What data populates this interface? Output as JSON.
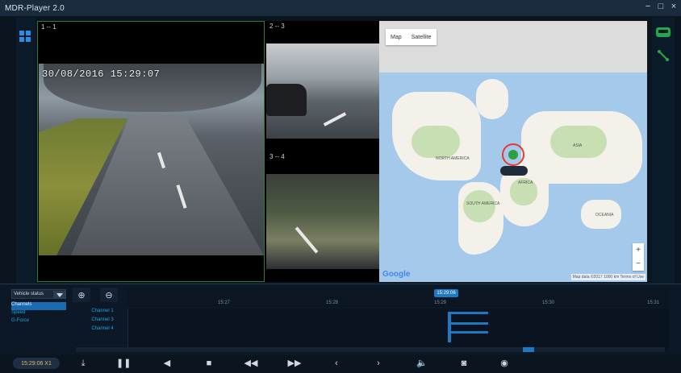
{
  "app": {
    "title": "MDR-Player 2.0"
  },
  "window_controls": {
    "minimize": "−",
    "restore": "□",
    "close": "×"
  },
  "video": {
    "panes": [
      {
        "label": "1 -- 1"
      },
      {
        "label": "2 -- 3"
      },
      {
        "label": "3 -- 4"
      }
    ],
    "main_timestamp": "30/08/2016 15:29:07"
  },
  "map": {
    "tabs": {
      "map": "Map",
      "satellite": "Satellite"
    },
    "labels": {
      "north_america": "NORTH AMERICA",
      "south_america": "SOUTH AMERICA",
      "africa": "AFRICA",
      "asia": "ASIA",
      "oceania": "OCEANIA"
    },
    "zoom_in": "+",
    "zoom_out": "−",
    "google": "Google",
    "attribution": "Map data ©2017   1000 km   Terms of Use"
  },
  "timeline": {
    "vehicle_status_label": "Vehicle status",
    "zoom_in_label": "⊕",
    "zoom_out_label": "⊖",
    "status_items": [
      {
        "label": "Channels",
        "selected": true
      },
      {
        "label": "Speed",
        "selected": false
      },
      {
        "label": "G-Force",
        "selected": false
      }
    ],
    "channel_rows": [
      "Channel 1",
      "Channel 3",
      "Channel 4"
    ],
    "ticks": [
      "15:27",
      "15:28",
      "15:29",
      "15:30",
      "15:31"
    ],
    "cursor_time": "15:29:06"
  },
  "controls": {
    "time_display": "15:29:06 X1",
    "icons": [
      "download-icon",
      "pause-icon",
      "step-back-icon",
      "stop-icon",
      "rewind-icon",
      "fast-forward-icon",
      "prev-icon",
      "next-icon",
      "volume-icon",
      "camera-icon",
      "eye-icon"
    ]
  },
  "colors": {
    "accent": "#1e78c2",
    "selected_pane_border": "#2e7d32",
    "pin_ring": "#e53935"
  }
}
